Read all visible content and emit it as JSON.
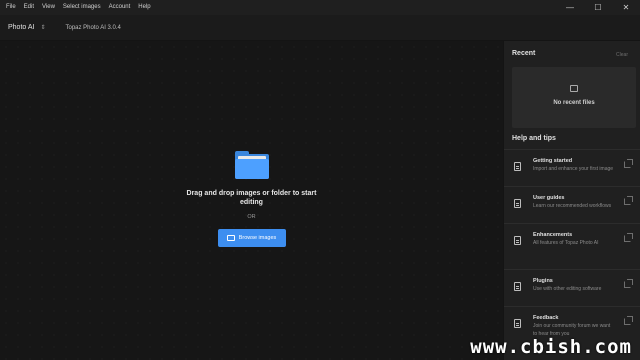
{
  "menu": [
    "File",
    "Edit",
    "View",
    "Select images",
    "Account",
    "Help"
  ],
  "window_controls": {
    "minimize": "—",
    "maximize": "☐",
    "close": "✕"
  },
  "appbar": {
    "app_name": "Photo AI",
    "chevron": "⇕",
    "version": "Topaz Photo AI 3.0.4"
  },
  "drop_area": {
    "title": "Drag and drop images or folder to start editing",
    "or": "OR",
    "browse_label": "Browse images"
  },
  "sidebar": {
    "recent_title": "Recent",
    "clear_label": "Clear",
    "no_recent": "No recent files",
    "help_title": "Help and tips",
    "tips": [
      {
        "title": "Getting started",
        "desc": "Import and enhance your first image"
      },
      {
        "title": "User guides",
        "desc": "Learn our recommended workflows"
      },
      {
        "title": "Enhancements",
        "desc": "All features of Topaz Photo AI"
      },
      {
        "title": "Plugins",
        "desc": "Use with other editing software"
      },
      {
        "title": "Feedback",
        "desc": "Join our community forum we want to hear from you"
      }
    ]
  },
  "watermark": "www.cbish.com"
}
